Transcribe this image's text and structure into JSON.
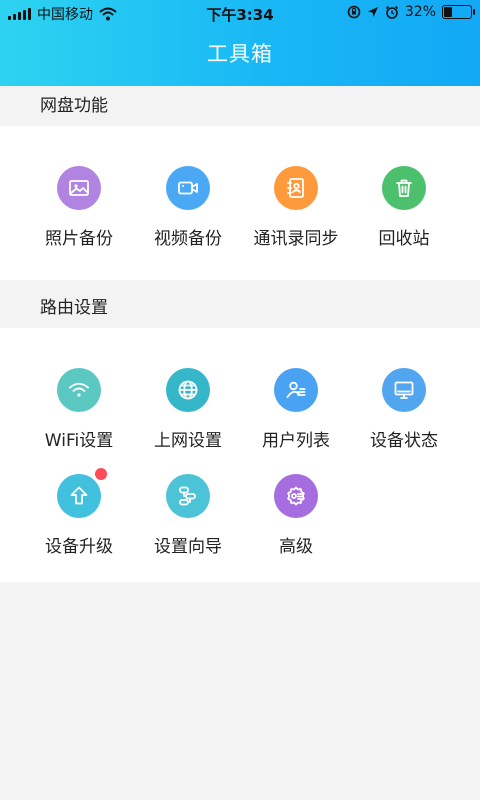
{
  "status_bar": {
    "carrier": "中国移动",
    "time": "下午3:34",
    "battery": "32%",
    "battery_level": 0.32
  },
  "header": {
    "title": "工具箱"
  },
  "sections": [
    {
      "label": "网盘功能",
      "items": [
        {
          "label": "照片备份",
          "icon": "image-icon",
          "color": "#b084e0"
        },
        {
          "label": "视频备份",
          "icon": "video-camera-icon",
          "color": "#4aa8f5"
        },
        {
          "label": "通讯录同步",
          "icon": "contacts-icon",
          "color": "#ff9a3c"
        },
        {
          "label": "回收站",
          "icon": "trash-icon",
          "color": "#4cc06c"
        }
      ]
    },
    {
      "label": "路由设置",
      "items": [
        {
          "label": "WiFi设置",
          "icon": "wifi-icon",
          "color": "#5bc8c2"
        },
        {
          "label": "上网设置",
          "icon": "globe-icon",
          "color": "#36b7c9"
        },
        {
          "label": "用户列表",
          "icon": "user-list-icon",
          "color": "#4aa3f2"
        },
        {
          "label": "设备状态",
          "icon": "monitor-icon",
          "color": "#52a6f0"
        },
        {
          "label": "设备升级",
          "icon": "upgrade-arrow-icon",
          "color": "#42c1de",
          "badge": true
        },
        {
          "label": "设置向导",
          "icon": "wizard-icon",
          "color": "#4cc3d6"
        },
        {
          "label": "高级",
          "icon": "advanced-gear-icon",
          "color": "#a66de0"
        }
      ]
    }
  ]
}
